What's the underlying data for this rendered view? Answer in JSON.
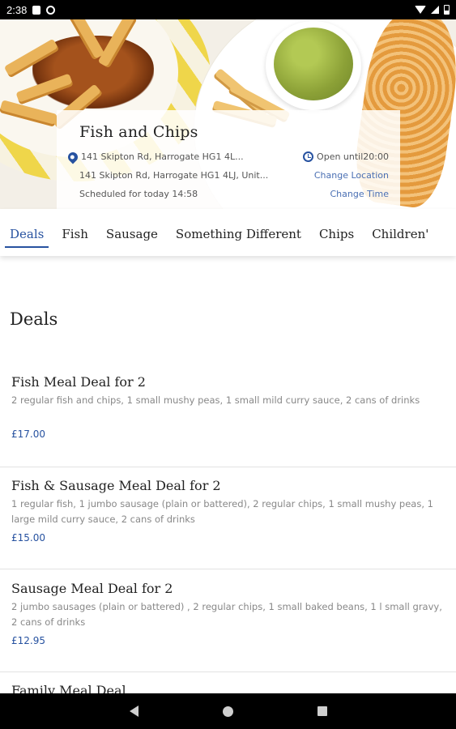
{
  "status_bar": {
    "time": "2:38"
  },
  "restaurant": {
    "name": "Fish and Chips",
    "address_short": "141 Skipton Rd, Harrogate HG1 4L...",
    "address_full": "141 Skipton Rd, Harrogate HG1 4LJ, Unit...",
    "scheduled": "Scheduled for today 14:58",
    "open_until": "Open until20:00",
    "change_location": "Change Location",
    "change_time": "Change Time"
  },
  "tabs": [
    {
      "label": "Deals",
      "active": true
    },
    {
      "label": "Fish"
    },
    {
      "label": "Sausage"
    },
    {
      "label": "Something Different"
    },
    {
      "label": "Chips"
    },
    {
      "label": "Children'"
    }
  ],
  "section": {
    "title": "Deals"
  },
  "deals": [
    {
      "title": "Fish Meal Deal for 2",
      "description": "2 regular fish and chips, 1 small mushy peas, 1 small mild curry sauce, 2 cans of drinks",
      "price": "£17.00"
    },
    {
      "title": "Fish & Sausage Meal Deal for 2",
      "description": "1 regular fish, 1 jumbo sausage (plain or battered), 2 regular chips, 1 small mushy peas, 1 large mild curry sauce, 2 cans of drinks",
      "price": "£15.00"
    },
    {
      "title": "Sausage Meal Deal for 2",
      "description": "2 jumbo sausages (plain or battered) , 2 regular chips, 1 small baked beans, 1 l small gravy, 2 cans of drinks",
      "price": "£12.95"
    },
    {
      "title": "Family Meal Deal"
    }
  ],
  "colors": {
    "accent": "#2752a0",
    "muted_text": "#888888"
  },
  "icons": {
    "location": "map-pin-icon",
    "hours": "clock-icon"
  }
}
